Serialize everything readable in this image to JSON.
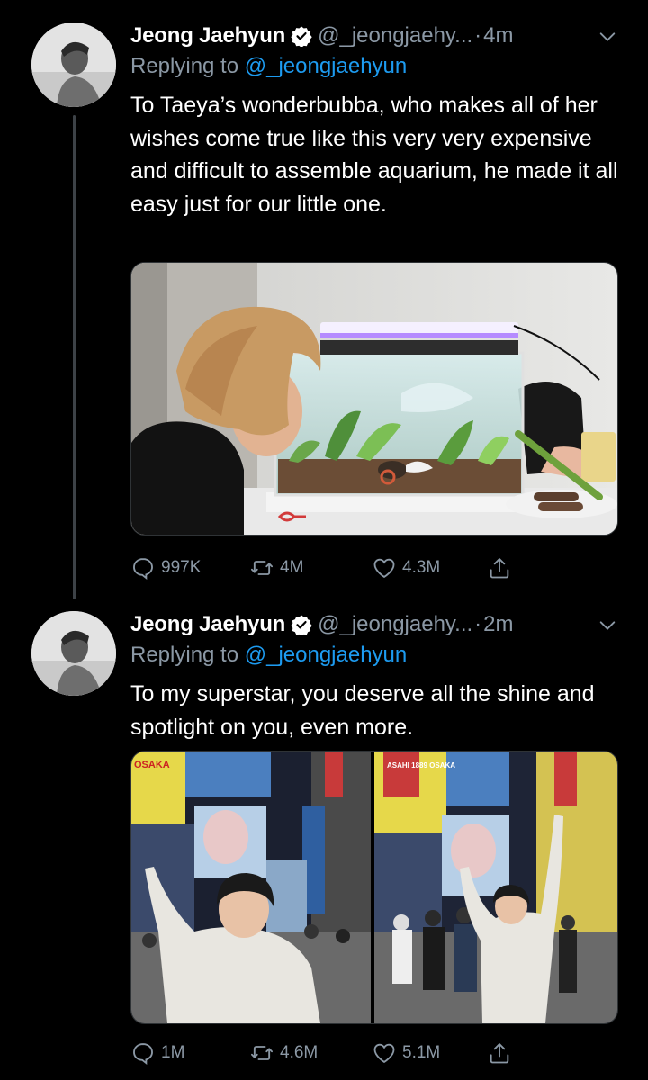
{
  "tweets": [
    {
      "name": "Jeong Jaehyun",
      "handle": "@_jeongjaehy...",
      "time": "4m",
      "reply_prefix": "Replying to",
      "reply_to": "@_jeongjaehyun",
      "text": "To Taeya’s wonderbubba, who makes all of her wishes come true like this very very expensive and difficult to assemble aquarium, he made it all easy just for our little one.",
      "image_label": "photo-aquarium",
      "replies": "997K",
      "retweets": "4M",
      "likes": "4.3M"
    },
    {
      "name": "Jeong Jaehyun",
      "handle": "@_jeongjaehy...",
      "time": "2m",
      "reply_prefix": "Replying to",
      "reply_to": "@_jeongjaehyun",
      "text": "To my superstar, you deserve all the shine and spotlight on you, even more.",
      "image_sign_1": "OSAKA",
      "image_sign_2": "ASAHI 1889 OSAKA",
      "replies": "1M",
      "retweets": "4.6M",
      "likes": "5.1M"
    }
  ],
  "colors": {
    "background": "#000000",
    "secondary_text": "#8b98a5",
    "mention": "#1d9bf0",
    "verified": "#ffffff"
  },
  "icons": [
    "verified-icon",
    "chevron-down-icon",
    "reply-icon",
    "retweet-icon",
    "like-icon",
    "share-icon"
  ]
}
